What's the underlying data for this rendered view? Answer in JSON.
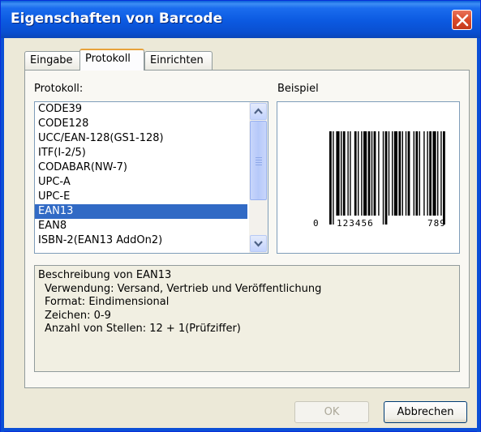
{
  "window": {
    "title": "Eigenschaften von Barcode"
  },
  "tabs": [
    {
      "label": "Eingabe"
    },
    {
      "label": "Protokoll"
    },
    {
      "label": "Einrichten"
    }
  ],
  "protocol": {
    "label": "Protokoll:",
    "items": [
      "CODE39",
      "CODE128",
      "UCC/EAN-128(GS1-128)",
      "ITF(I-2/5)",
      "CODABAR(NW-7)",
      "UPC-A",
      "UPC-E",
      "EAN13",
      "EAN8",
      "ISBN-2(EAN13 AddOn2)"
    ],
    "selected": "EAN13",
    "selected_color": "#316ac5"
  },
  "example": {
    "label": "Beispiel",
    "digits_left": "0",
    "digits_mid": "123456",
    "digits_right": "789"
  },
  "description": {
    "title": "Beschreibung von EAN13",
    "lines": [
      "Verwendung: Versand, Vertrieb und Veröffentlichung",
      "Format: Eindimensional",
      "Zeichen: 0-9",
      "Anzahl von Stellen: 12 + 1(Prüfziffer)"
    ]
  },
  "buttons": {
    "ok": "OK",
    "cancel": "Abbrechen"
  },
  "icons": {
    "close": "close-icon",
    "scroll_up": "chevron-up-icon",
    "scroll_down": "chevron-down-icon"
  }
}
